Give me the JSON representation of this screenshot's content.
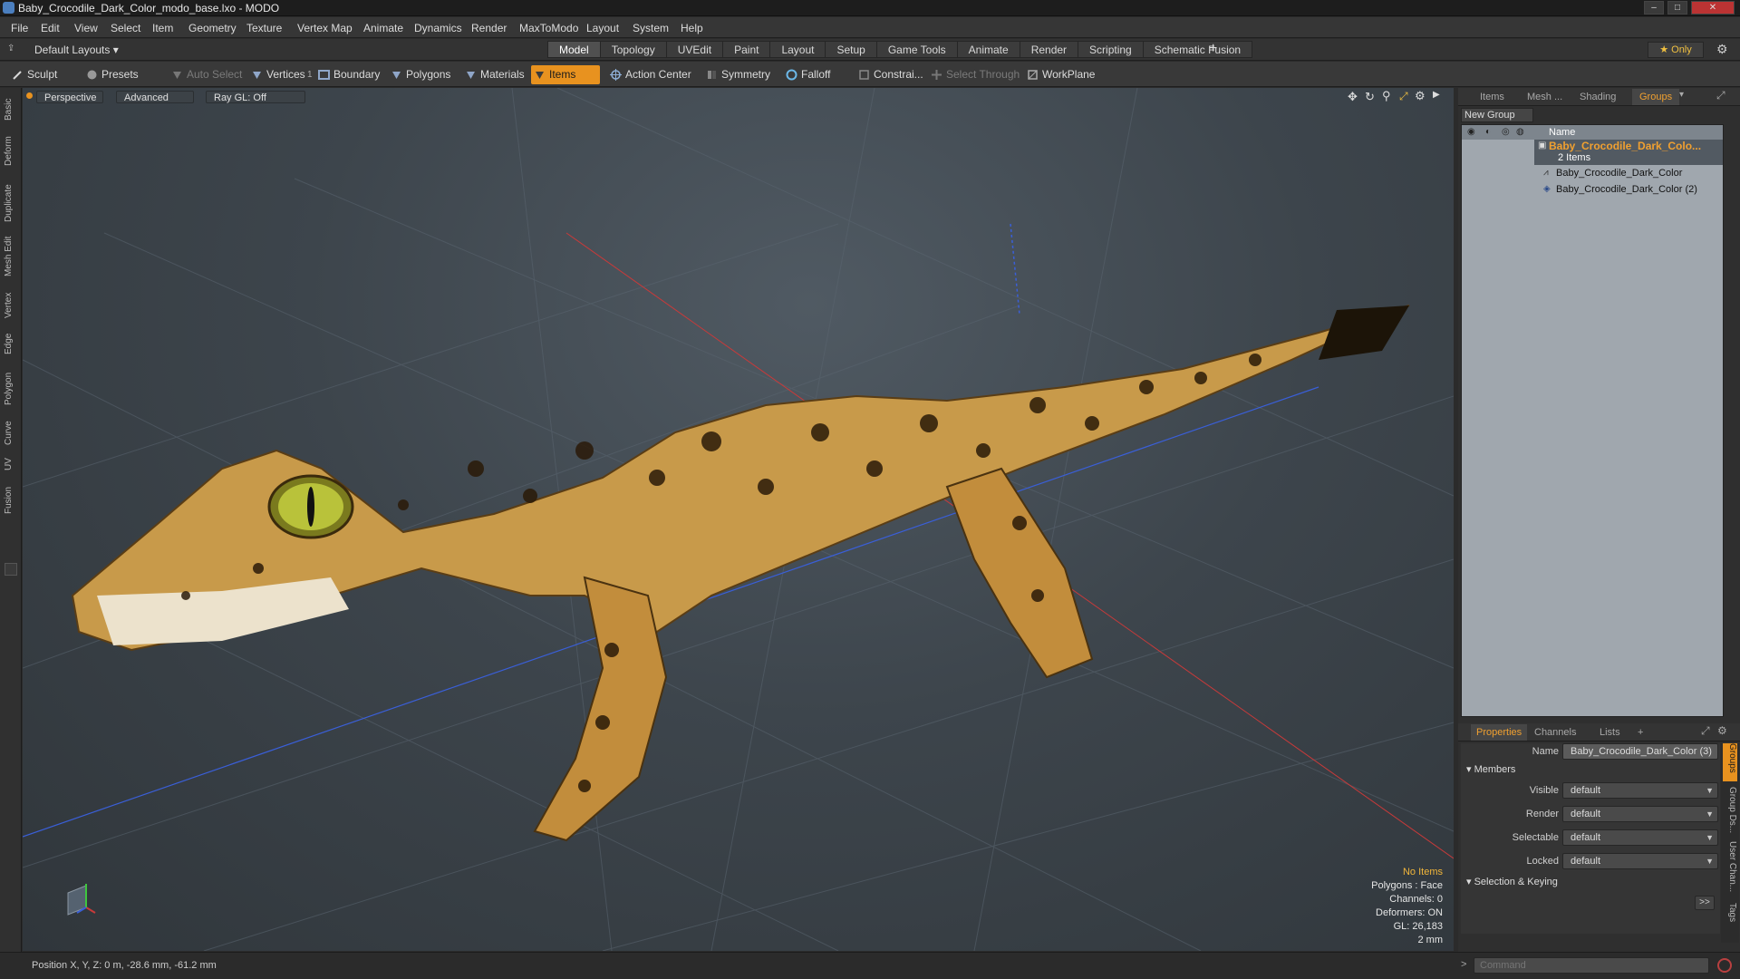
{
  "window": {
    "title": "Baby_Crocodile_Dark_Color_modo_base.lxo - MODO",
    "controls": [
      "–",
      "□",
      "✕"
    ]
  },
  "menu": [
    "File",
    "Edit",
    "View",
    "Select",
    "Item",
    "Geometry",
    "Texture",
    "Vertex Map",
    "Animate",
    "Dynamics",
    "Render",
    "MaxToModo",
    "Layout",
    "System",
    "Help"
  ],
  "layout_selector": "Default Layouts ▾",
  "mode_tabs": [
    "Model",
    "Topology",
    "UVEdit",
    "Paint",
    "Layout",
    "Setup",
    "Game Tools",
    "Animate",
    "Render",
    "Scripting",
    "Schematic Fusion"
  ],
  "active_mode_tab": "Model",
  "add_tab": "+",
  "only_label": "★  Only",
  "toolbar": {
    "sculpt": "Sculpt",
    "presets": "Presets",
    "auto_select": "Auto Select",
    "vertices": "Vertices",
    "vertices_count": "1",
    "boundary": "Boundary",
    "polygons": "Polygons",
    "materials": "Materials",
    "items": "Items",
    "action_center": "Action Center",
    "symmetry": "Symmetry",
    "falloff": "Falloff",
    "constraints": "Constrai...",
    "select_through": "Select Through",
    "workplane": "WorkPlane"
  },
  "left_tabs": [
    "Basic",
    "Deform",
    "Duplicate",
    "Mesh Edit",
    "Vertex",
    "Edge",
    "Polygon",
    "Curve",
    "UV",
    "Fusion"
  ],
  "viewport": {
    "view": "Perspective",
    "shading": "Advanced",
    "raygl": "Ray GL: Off",
    "stats": {
      "no_items": "No Items",
      "polygons": "Polygons : Face",
      "channels": "Channels: 0",
      "deformers": "Deformers: ON",
      "gl": "GL: 26,183",
      "grid": "2 mm"
    }
  },
  "panel_tabs": [
    "Items",
    "Mesh ...",
    "Shading",
    "Groups"
  ],
  "active_panel_tab": "Groups",
  "groups": {
    "new_group": "New Group",
    "column_name": "Name",
    "root_label": "Baby_Crocodile_Dark_Colo...",
    "root_count": "2 Items",
    "children": [
      "Baby_Crocodile_Dark_Color",
      "Baby_Crocodile_Dark_Color (2)"
    ]
  },
  "properties": {
    "tabs": [
      "Properties",
      "Channels",
      "Lists",
      "+"
    ],
    "name_label": "Name",
    "name_value": "Baby_Crocodile_Dark_Color (3)",
    "members_header": "Members",
    "visible_label": "Visible",
    "render_label": "Render",
    "selectable_label": "Selectable",
    "locked_label": "Locked",
    "default_value": "default",
    "selection_header": "Selection & Keying",
    "more_btn": ">>",
    "side_tabs": [
      "Groups",
      "Group Ds...",
      "User Chan...",
      "Tags"
    ]
  },
  "status": {
    "position": "Position X, Y, Z:   0 m, -28.6 mm, -61.2 mm",
    "command_placeholder": "Command",
    "prompt": ">"
  },
  "colors": {
    "accent": "#e8921f",
    "group_root": "#f0a030",
    "axis_x": "#c83a3a",
    "axis_y": "#3fc63f",
    "axis_z": "#3a5fd8"
  }
}
